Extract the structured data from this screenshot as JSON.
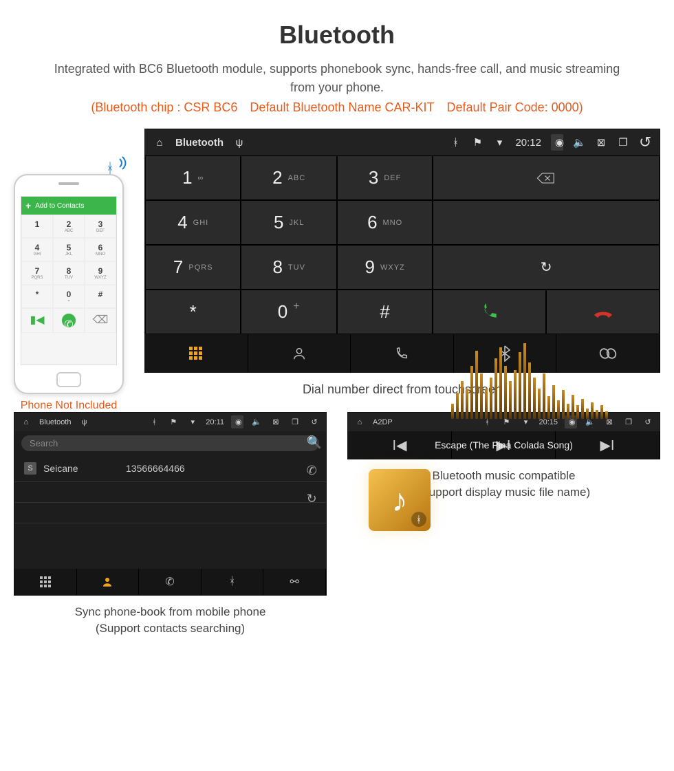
{
  "title": "Bluetooth",
  "description": "Integrated with BC6 Bluetooth module, supports phonebook sync, hands-free call, and music streaming from your phone.",
  "spec": "(Bluetooth chip : CSR BC6 Default Bluetooth Name CAR-KIT Default Pair Code: 0000)",
  "phone": {
    "add_contact": "Add to Contacts",
    "caption": "Phone Not Included",
    "keys": [
      {
        "n": "1",
        "l": ""
      },
      {
        "n": "2",
        "l": "ABC"
      },
      {
        "n": "3",
        "l": "DEF"
      },
      {
        "n": "4",
        "l": "GHI"
      },
      {
        "n": "5",
        "l": "JKL"
      },
      {
        "n": "6",
        "l": "MNO"
      },
      {
        "n": "7",
        "l": "PQRS"
      },
      {
        "n": "8",
        "l": "TUV"
      },
      {
        "n": "9",
        "l": "WXYZ"
      },
      {
        "n": "*",
        "l": ""
      },
      {
        "n": "0",
        "l": "+"
      },
      {
        "n": "#",
        "l": ""
      }
    ]
  },
  "unit": {
    "status_title": "Bluetooth",
    "status_time": "20:12",
    "keys": [
      {
        "n": "1",
        "l": "∞"
      },
      {
        "n": "2",
        "l": "ABC"
      },
      {
        "n": "3",
        "l": "DEF"
      },
      {
        "n": "4",
        "l": "GHI"
      },
      {
        "n": "5",
        "l": "JKL"
      },
      {
        "n": "6",
        "l": "MNO"
      },
      {
        "n": "7",
        "l": "PQRS"
      },
      {
        "n": "8",
        "l": "TUV"
      },
      {
        "n": "9",
        "l": "WXYZ"
      },
      {
        "n": "*",
        "l": ""
      },
      {
        "n": "0",
        "l": "+"
      },
      {
        "n": "#",
        "l": ""
      }
    ],
    "caption": "Dial number direct from touchscreen"
  },
  "contacts": {
    "status_title": "Bluetooth",
    "status_time": "20:11",
    "search_placeholder": "Search",
    "contact_name": "Seicane",
    "contact_number": "13566664466",
    "contact_initial": "S",
    "caption_l1": "Sync phone-book from mobile phone",
    "caption_l2": "(Support contacts searching)"
  },
  "music": {
    "status_title": "A2DP",
    "status_time": "20:15",
    "track": "Escape (The Pina Colada Song)",
    "caption_l1": "Bluetooth music compatible",
    "caption_l2": "(Support display music file name)",
    "bars": [
      20,
      35,
      50,
      40,
      70,
      90,
      60,
      40,
      55,
      80,
      95,
      70,
      50,
      65,
      88,
      100,
      75,
      55,
      40,
      60,
      30,
      45,
      25,
      38,
      20,
      32,
      18,
      26,
      14,
      22,
      12,
      18,
      10
    ]
  }
}
